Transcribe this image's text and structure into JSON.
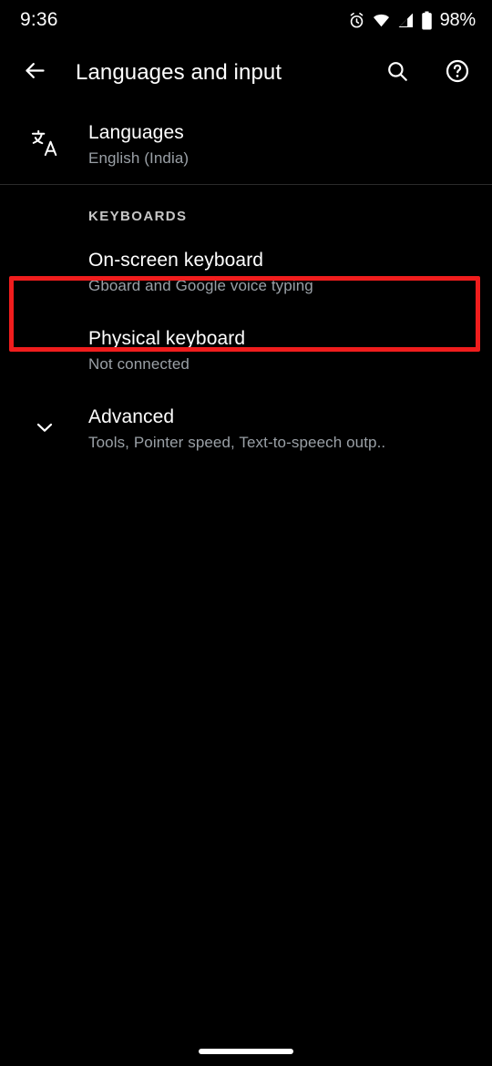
{
  "status_bar": {
    "time": "9:36",
    "battery_percent": "98%",
    "icons": [
      "alarm-icon",
      "wifi-icon",
      "cellular-signal-icon",
      "battery-icon"
    ]
  },
  "app_bar": {
    "back_icon": "back-arrow-icon",
    "title": "Languages and input",
    "search_icon": "search-icon",
    "help_icon": "help-icon"
  },
  "list": {
    "languages_row": {
      "icon": "translate-icon",
      "title": "Languages",
      "subtitle": "English (India)"
    },
    "keyboards_header": "KEYBOARDS",
    "onscreen_keyboard_row": {
      "title": "On-screen keyboard",
      "subtitle": "Gboard and Google voice typing"
    },
    "physical_keyboard_row": {
      "title": "Physical keyboard",
      "subtitle": "Not connected"
    },
    "advanced_row": {
      "icon": "chevron-down-icon",
      "title": "Advanced",
      "subtitle": "Tools, Pointer speed, Text-to-speech outp.."
    }
  },
  "annotation": {
    "highlight_color": "#f01d1d",
    "target": "on-screen-keyboard-row"
  },
  "colors": {
    "background": "#000000",
    "primary_text": "#ffffff",
    "secondary_text": "#9aa0a6",
    "divider": "#2b2b2b"
  }
}
